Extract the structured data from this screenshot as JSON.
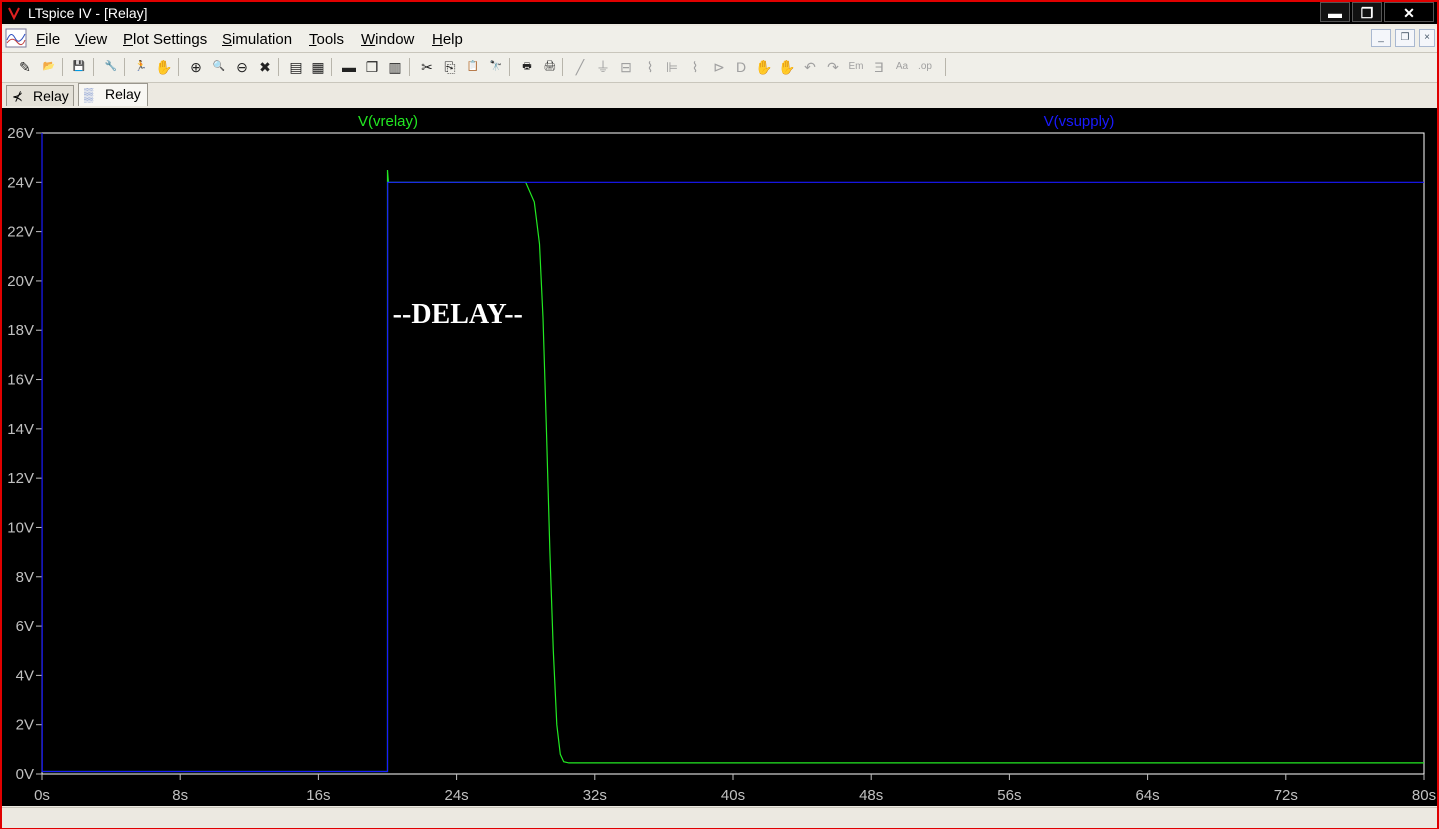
{
  "window": {
    "title": "LTspice IV - [Relay]",
    "minimize_glyph": "▬",
    "restore_glyph": "❐",
    "close_glyph": "✕"
  },
  "menu": {
    "items": [
      "File",
      "View",
      "Plot Settings",
      "Simulation",
      "Tools",
      "Window",
      "Help"
    ],
    "mdi_minimize": "_",
    "mdi_restore": "❐",
    "mdi_close": "×"
  },
  "toolbar": {
    "icons": [
      "new-schematic-icon",
      "open-icon",
      "save-icon",
      "control-panel-icon",
      "run-icon",
      "pan-hand-icon",
      "zoom-in-icon",
      "zoom-area-icon",
      "zoom-out-icon",
      "zoom-cancel-icon",
      "autorange-icon",
      "grid-icon",
      "tile-horizontal-icon",
      "cascade-icon",
      "tile-vertical-icon",
      "cut-icon",
      "copy-icon",
      "paste-icon",
      "find-icon",
      "print-preview-icon",
      "print-icon",
      "draw-wire-icon",
      "ground-icon",
      "label-net-icon",
      "resistor-icon",
      "capacitor-icon",
      "inductor-icon",
      "diode-icon",
      "component-icon",
      "move-icon",
      "drag-icon",
      "undo-icon",
      "redo-icon",
      "rotate-icon",
      "mirror-icon",
      "text-icon",
      "spice-directive-icon"
    ],
    "glyphs": [
      "✎",
      "📂",
      "💾",
      "🔧",
      "🏃",
      "✋",
      "⊕",
      "🔍",
      "⊖",
      "✖",
      "▤",
      "▦",
      "▬",
      "❐",
      "▥",
      "✂",
      "⎘",
      "📋",
      "🔭",
      "🖶",
      "🖨",
      "╱",
      "⏚",
      "⊟",
      "⌇",
      "⊫",
      "⌇",
      "⊳",
      "D",
      "✋",
      "✋",
      "↶",
      "↷",
      "Em",
      "Ǝ",
      "Aa",
      ".op"
    ]
  },
  "tabs": [
    {
      "label": "Relay",
      "icon": "schematic-icon",
      "glyph": "⊀"
    },
    {
      "label": "Relay",
      "icon": "waveform-icon",
      "glyph": "▒"
    }
  ],
  "colors": {
    "background": "#000000",
    "frame": "#ffffff",
    "vrelay": "#22e822",
    "vsupply": "#1a1aff",
    "axis_text": "#c0c0c0",
    "annotation": "#ffffff"
  },
  "annotation_text": "--DELAY--",
  "chart_data": {
    "type": "line",
    "title": "",
    "xlabel": "",
    "ylabel": "",
    "xlim": [
      0,
      80
    ],
    "ylim": [
      0,
      26
    ],
    "x_ticks": [
      "0s",
      "8s",
      "16s",
      "24s",
      "32s",
      "40s",
      "48s",
      "56s",
      "64s",
      "72s",
      "80s"
    ],
    "y_ticks": [
      "0V",
      "2V",
      "4V",
      "6V",
      "8V",
      "10V",
      "12V",
      "14V",
      "16V",
      "18V",
      "20V",
      "22V",
      "24V",
      "26V"
    ],
    "grid": false,
    "series": [
      {
        "name": "V(vrelay)",
        "x": [
          0,
          0.3,
          20,
          20,
          20.05,
          28,
          28.5,
          28.8,
          29.0,
          29.2,
          29.4,
          29.6,
          29.8,
          30,
          30.2,
          30.5,
          80
        ],
        "y": [
          0.1,
          0.1,
          0.1,
          24.5,
          24,
          24,
          23.2,
          21.5,
          18.5,
          14,
          9,
          5,
          2,
          0.8,
          0.5,
          0.45,
          0.45
        ]
      },
      {
        "name": "V(vsupply)",
        "x": [
          0,
          0.01,
          20,
          20.01,
          80
        ],
        "y": [
          26,
          0.1,
          0.1,
          24,
          24
        ]
      }
    ]
  }
}
